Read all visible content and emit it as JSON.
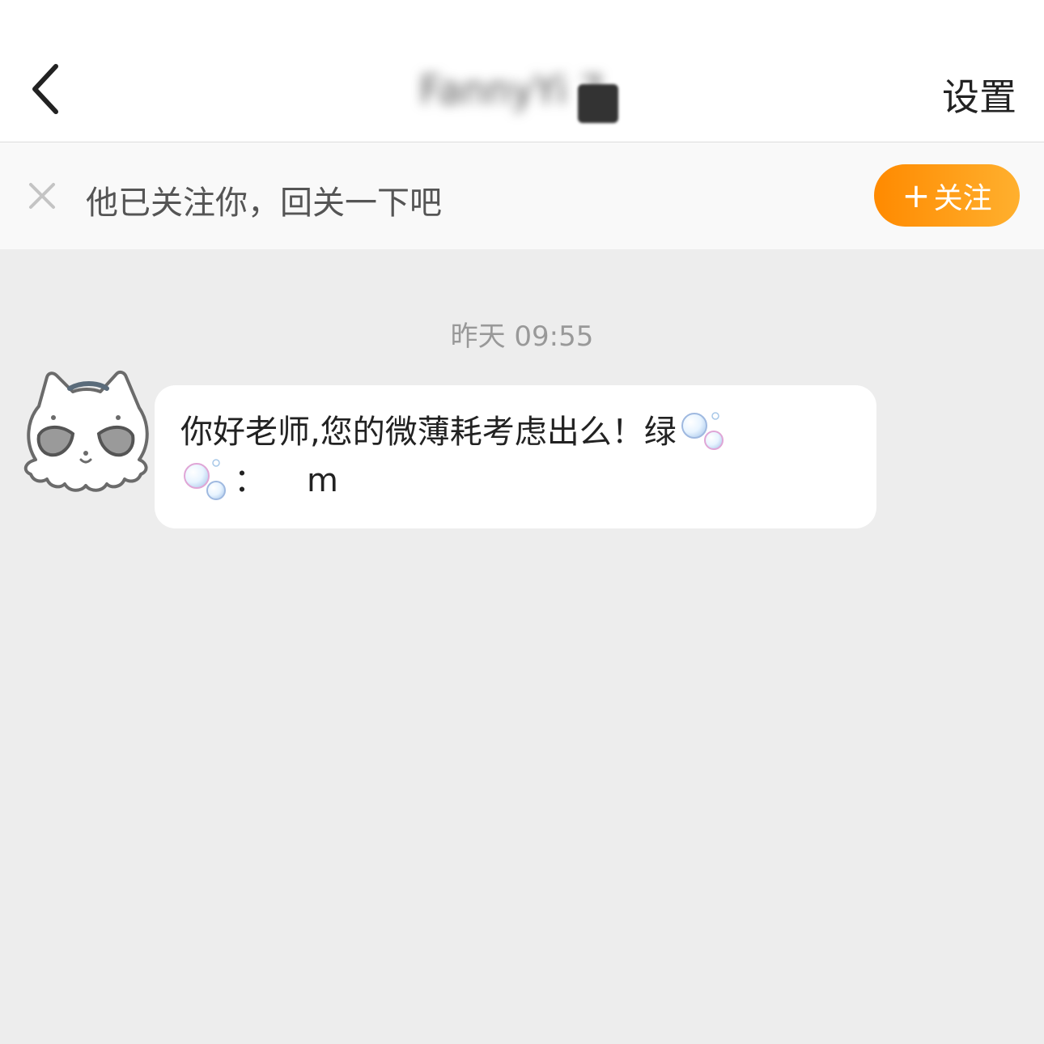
{
  "header": {
    "title": "FannyYi 7",
    "settings_label": "设置"
  },
  "follow_bar": {
    "message": "他已关注你，回关一下吧",
    "follow_button_label": "关注",
    "follow_button_icon": "plus-icon"
  },
  "chat": {
    "timestamp": "昨天 09:55",
    "messages": [
      {
        "sender_avatar": "cat-avatar",
        "line1_text": "你好老师,您的微薄耗考虑出么！绿",
        "line2_colon": "：",
        "line2_handle": "m"
      }
    ]
  },
  "colors": {
    "accent_orange_start": "#ff8a00",
    "accent_orange_end": "#ffb02e",
    "chat_background": "#ededed"
  }
}
